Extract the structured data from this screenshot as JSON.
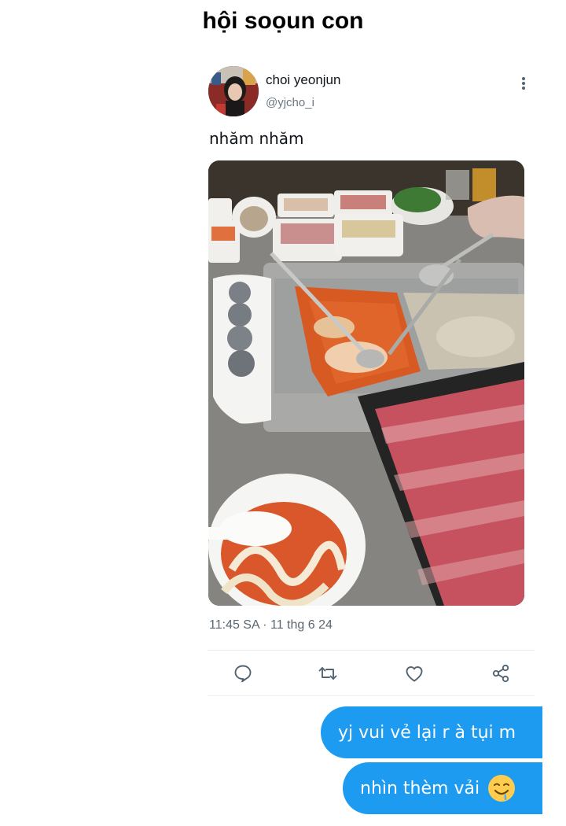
{
  "chat": {
    "title": "hội soọun con"
  },
  "tweet": {
    "author_name": "choi yeonjun",
    "author_handle": "@yjcho_i",
    "text": "nhăm nhăm",
    "time": "11:45 SA",
    "separator": "·",
    "date": "11 thg 6 24",
    "photo": {
      "description_icon": "hotpot-photo"
    },
    "actions": [
      {
        "name": "reply",
        "icon": "speech-bubble-icon"
      },
      {
        "name": "retweet",
        "icon": "retweet-icon"
      },
      {
        "name": "like",
        "icon": "heart-icon"
      },
      {
        "name": "share",
        "icon": "share-icon"
      }
    ]
  },
  "messages": [
    {
      "text": "yj vui vẻ lại r à tụi m"
    },
    {
      "text": "nhìn thèm vải",
      "emoji": "drooling-face-emoji"
    }
  ],
  "colors": {
    "bubble": "#1d9bf0",
    "meta_text": "#5b6670",
    "icon": "#536471"
  }
}
